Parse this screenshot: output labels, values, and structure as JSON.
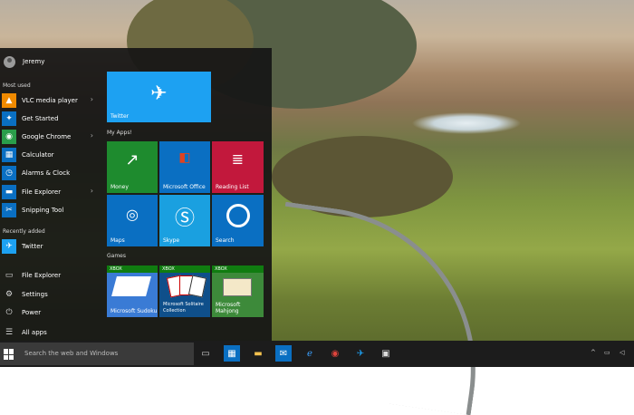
{
  "user": {
    "name": "Jeremy"
  },
  "sections": {
    "most_used": "Most used",
    "recently_added": "Recently added"
  },
  "most_used": [
    {
      "label": "VLC media player",
      "icon": "vlc-cone-icon",
      "color": "#f08a00",
      "has_submenu": true
    },
    {
      "label": "Get Started",
      "icon": "lightbulb-icon",
      "color": "#0a6fc2",
      "has_submenu": false
    },
    {
      "label": "Google Chrome",
      "icon": "chrome-icon",
      "color": "#2a9d4a",
      "has_submenu": true
    },
    {
      "label": "Calculator",
      "icon": "calculator-icon",
      "color": "#0a6fc2",
      "has_submenu": false
    },
    {
      "label": "Alarms & Clock",
      "icon": "alarm-clock-icon",
      "color": "#0a6fc2",
      "has_submenu": false
    },
    {
      "label": "File Explorer",
      "icon": "folder-icon",
      "color": "#0a6fc2",
      "has_submenu": true
    },
    {
      "label": "Snipping Tool",
      "icon": "scissors-icon",
      "color": "#0a6fc2",
      "has_submenu": false
    }
  ],
  "recently_added": [
    {
      "label": "Twitter",
      "icon": "twitter-bird-icon",
      "color": "#1da1f2"
    }
  ],
  "system": [
    {
      "label": "File Explorer",
      "icon": "folder-outline-icon"
    },
    {
      "label": "Settings",
      "icon": "gear-icon"
    },
    {
      "label": "Power",
      "icon": "power-icon"
    },
    {
      "label": "All apps",
      "icon": "list-icon"
    }
  ],
  "tile_groups": {
    "apps": "My Apps!",
    "games": "Games"
  },
  "tiles": {
    "twitter": {
      "label": "Twitter",
      "color": "#1da1f2",
      "icon": "twitter-bird-icon"
    },
    "money": {
      "label": "Money",
      "color": "#1e8b2e",
      "icon": "chart-up-icon"
    },
    "office": {
      "label": "Microsoft Office",
      "color": "#0a6fc2",
      "icon": "office-icon",
      "accent": "#e0431f"
    },
    "reading": {
      "label": "Reading List",
      "color": "#c2183c",
      "icon": "reading-list-icon"
    },
    "maps": {
      "label": "Maps",
      "color": "#0a6fc2",
      "icon": "maps-pin-icon"
    },
    "skype": {
      "label": "Skype",
      "color": "#1aa0e0",
      "icon": "skype-icon"
    },
    "search": {
      "label": "Search",
      "color": "#0a6fc2",
      "icon": "cortana-ring-icon"
    },
    "sudoku": {
      "label": "Microsoft Sudoku",
      "badge": "XBOX",
      "color": "#3a7bd5"
    },
    "solitaire": {
      "label": "Microsoft Solitaire Collection",
      "badge": "XBOX",
      "color": "#0f4f8a"
    },
    "mahjong": {
      "label": "Microsoft Mahjong",
      "badge": "XBOX",
      "color": "#3d8a3a"
    }
  },
  "taskbar": {
    "search_placeholder": "Search the web and Windows",
    "icons": [
      "task-view-icon",
      "store-icon",
      "file-explorer-icon",
      "outlook-icon",
      "edge-icon",
      "chrome-icon",
      "twitter-icon",
      "photos-icon"
    ]
  },
  "tray": {
    "chevron": "^",
    "battery": "▭",
    "volume": "◁"
  }
}
